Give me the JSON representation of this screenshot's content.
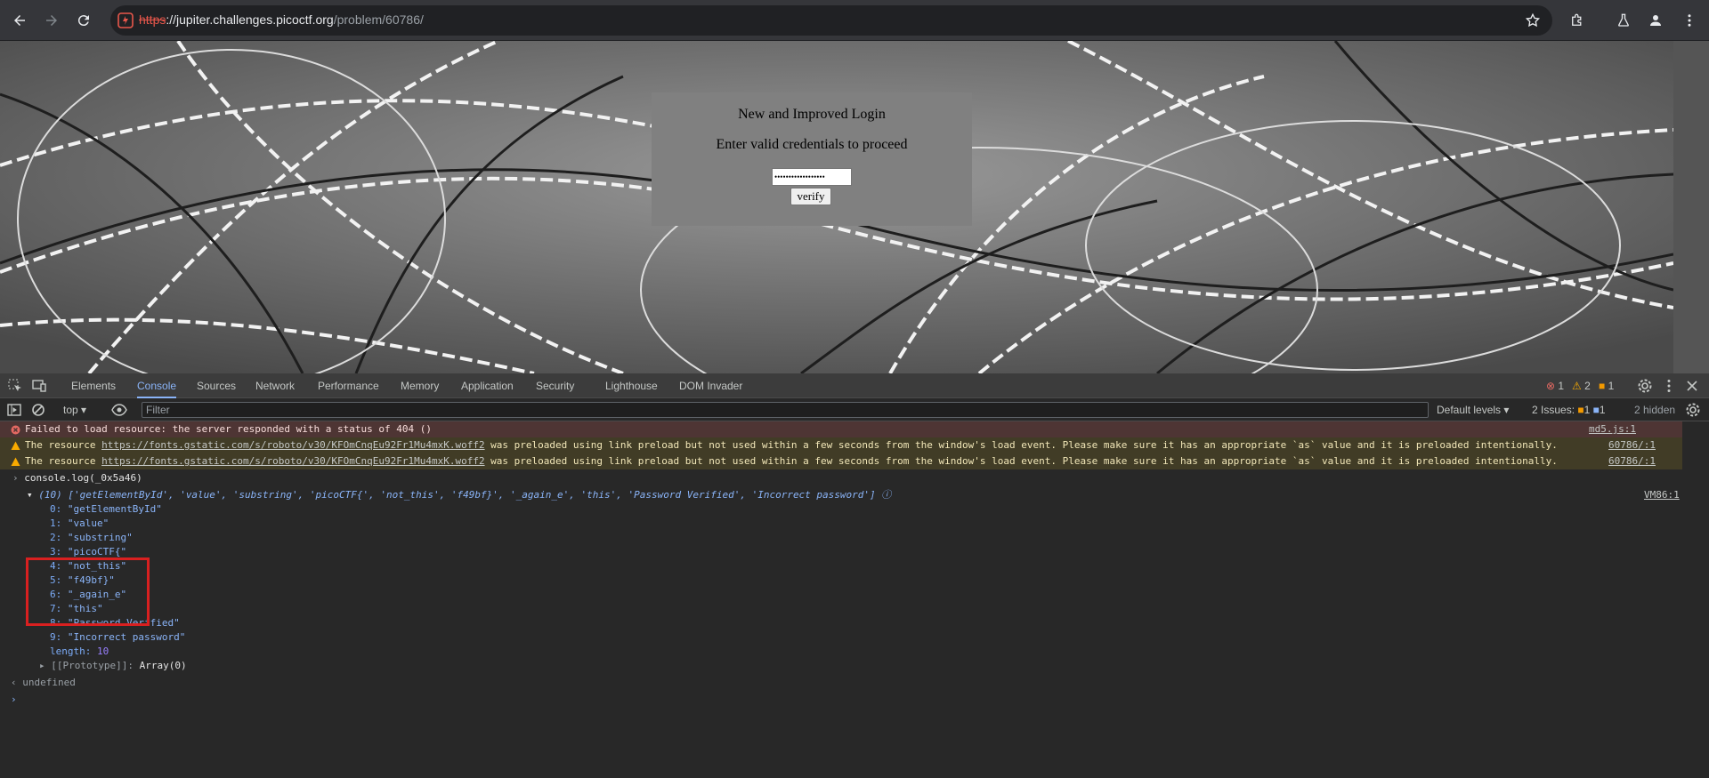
{
  "browser": {
    "url_scheme": "https",
    "url_host": "://jupiter.challenges.picoctf.org",
    "url_path": "/problem/60786/"
  },
  "page": {
    "login_title": "New and Improved Login",
    "login_subtitle": "Enter valid credentials to proceed",
    "password_value": "••••••••••••••••••",
    "verify_label": "verify"
  },
  "devtools": {
    "tabs": [
      "Elements",
      "Console",
      "Sources",
      "Network",
      "Performance",
      "Memory",
      "Application",
      "Security",
      "Lighthouse",
      "DOM Invader"
    ],
    "active_tab": "Console",
    "errors_count": "1",
    "warnings_count": "2",
    "issues_count": "1",
    "context": "top",
    "filter_placeholder": "Filter",
    "default_levels": "Default levels",
    "issues_label": "2 Issues:",
    "issues_warn": "1",
    "issues_info": "1",
    "hidden_label": "2 hidden"
  },
  "console": {
    "error_msg": "Failed to load resource: the server responded with a status of 404 ()",
    "error_src": "md5.js:1",
    "warn_prefix": "The resource ",
    "warn_link": "https://fonts.gstatic.com/s/roboto/v30/KFOmCnqEu92Fr1Mu4mxK.woff2",
    "warn_suffix": " was preloaded using link preload but not used within a few seconds from the window's load event. Please make sure it has an appropriate `as` value and it is preloaded intentionally.",
    "warn_src": "60786/:1",
    "input_cmd": "console.log(_0x5a46)",
    "array_summary": "(10) ['getElementById', 'value', 'substring', 'picoCTF{', 'not_this', 'f49bf}', '_again_e', 'this', 'Password Verified', 'Incorrect password']",
    "array_src": "VM86:1",
    "items": [
      {
        "k": "0",
        "v": "\"getElementById\""
      },
      {
        "k": "1",
        "v": "\"value\""
      },
      {
        "k": "2",
        "v": "\"substring\""
      },
      {
        "k": "3",
        "v": "\"picoCTF{\""
      },
      {
        "k": "4",
        "v": "\"not_this\""
      },
      {
        "k": "5",
        "v": "\"f49bf}\""
      },
      {
        "k": "6",
        "v": "\"_again_e\""
      },
      {
        "k": "7",
        "v": "\"this\""
      },
      {
        "k": "8",
        "v": "\"Password Verified\""
      },
      {
        "k": "9",
        "v": "\"Incorrect password\""
      }
    ],
    "length_key": "length",
    "length_val": "10",
    "prototype_key": "[[Prototype]]",
    "prototype_val": "Array(0)",
    "result": "undefined"
  },
  "colors": {
    "accent": "#8ab4f8",
    "error_bg": "#4e3534",
    "warn_bg": "#413c26",
    "highlight_box": "#d92020"
  }
}
